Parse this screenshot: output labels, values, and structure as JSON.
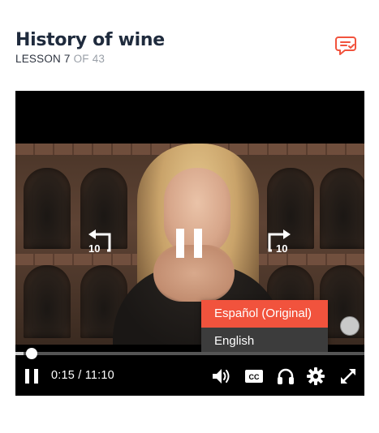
{
  "lesson": {
    "title": "History of wine",
    "label": "LESSON 7",
    "count": "OF 43"
  },
  "header": {
    "notes_icon": "notes-chat-icon"
  },
  "player": {
    "controls": {
      "rewind_icon": "replay-10-icon",
      "rewind_seconds": "10",
      "pause_icon": "pause-icon",
      "forward_icon": "forward-10-icon",
      "forward_seconds": "10"
    },
    "captions_menu": {
      "options": [
        {
          "label": "Español (Original)",
          "selected": true
        },
        {
          "label": "English",
          "selected": false
        }
      ]
    },
    "progress": {
      "fraction": 0.023
    },
    "time": {
      "current": "0:15",
      "total": "/ 11:10"
    },
    "bar_icons": [
      "pause-icon",
      "volume-icon",
      "closed-captions-icon",
      "audio-headphones-icon",
      "settings-gear-icon",
      "fullscreen-icon"
    ],
    "cc_label": "CC"
  },
  "colors": {
    "accent": "#f1533d",
    "title": "#1f2b3d",
    "menu_bg": "#3c3c3c"
  }
}
